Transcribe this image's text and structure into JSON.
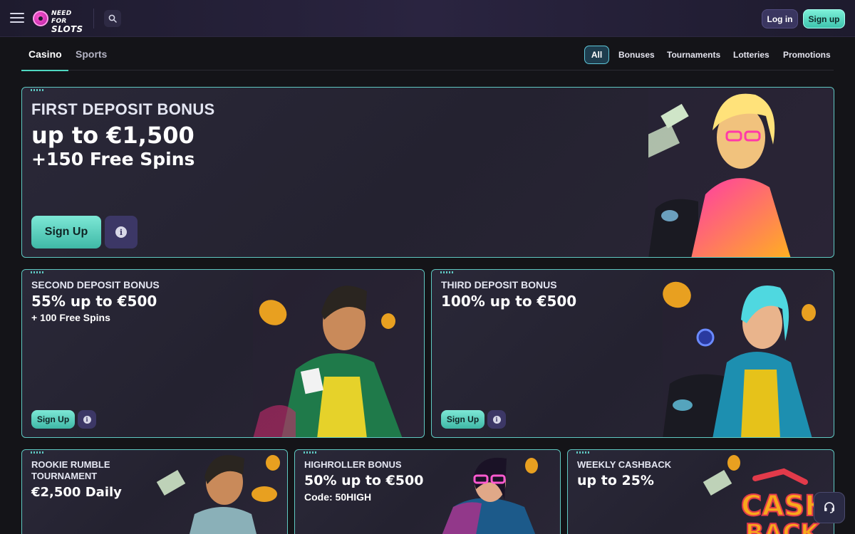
{
  "header": {
    "logo": {
      "line1": "NEED FOR",
      "line2": "SLOTS"
    },
    "login_label": "Log in",
    "signup_label": "Sign up"
  },
  "nav": {
    "tabs": [
      {
        "label": "Casino",
        "active": true
      },
      {
        "label": "Sports",
        "active": false
      }
    ],
    "filters": [
      {
        "label": "All",
        "active": true
      },
      {
        "label": "Bonuses",
        "active": false
      },
      {
        "label": "Tournaments",
        "active": false
      },
      {
        "label": "Lotteries",
        "active": false
      },
      {
        "label": "Promotions",
        "active": false
      }
    ]
  },
  "promos": {
    "first": {
      "title": "FIRST DEPOSIT BONUS",
      "amount": "up to €1,500",
      "extra": "+150 Free Spins",
      "button": "Sign Up"
    },
    "second": {
      "title": "SECOND DEPOSIT BONUS",
      "amount": "55% up to €500",
      "extra": "+ 100 Free Spins",
      "button": "Sign Up"
    },
    "third": {
      "title": "THIRD DEPOSIT BONUS",
      "amount": "100% up to €500",
      "button": "Sign Up"
    },
    "rookie": {
      "title_line1": "ROOKIE RUMBLE",
      "title_line2": "TOURNAMENT",
      "amount": "€2,500 Daily"
    },
    "highroller": {
      "title": "HIGHROLLER BONUS",
      "amount": "50% up to €500",
      "code": "Code: 50HIGH"
    },
    "cashback": {
      "title": "WEEKLY CASHBACK",
      "amount": "up to 25%",
      "art_text_1": "CASH",
      "art_text_2": "BACK"
    }
  },
  "colors": {
    "accent": "#5fc9c2",
    "signup": "#4fd8c0",
    "background": "#141418"
  }
}
